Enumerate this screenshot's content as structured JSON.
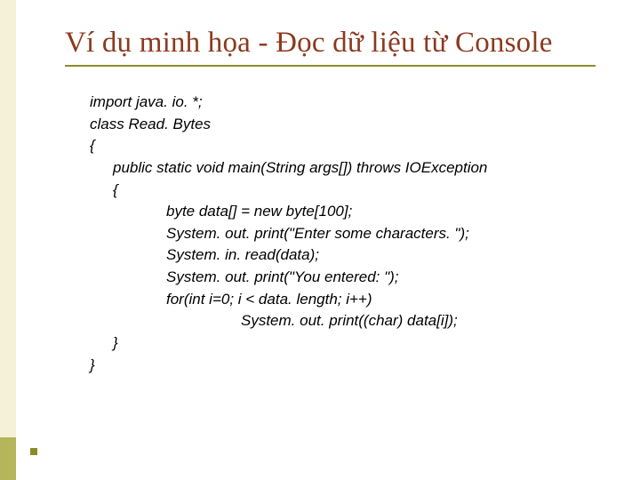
{
  "title": "Ví dụ minh họa - Đọc dữ liệu từ Console",
  "code": {
    "l1": "import java. io. *;",
    "l2": "class Read. Bytes",
    "l3": "{",
    "l4": "public static void main(String args[]) throws IOException",
    "l5": "{",
    "l6": "byte data[] = new byte[100];",
    "l7": "System. out. print(\"Enter some characters. \");",
    "l8": "System. in. read(data);",
    "l9": "System. out. print(\"You entered: \");",
    "l10": "for(int i=0; i < data. length; i++)",
    "l11": "System. out. print((char) data[i]);",
    "l12": "}",
    "l13": "}"
  }
}
